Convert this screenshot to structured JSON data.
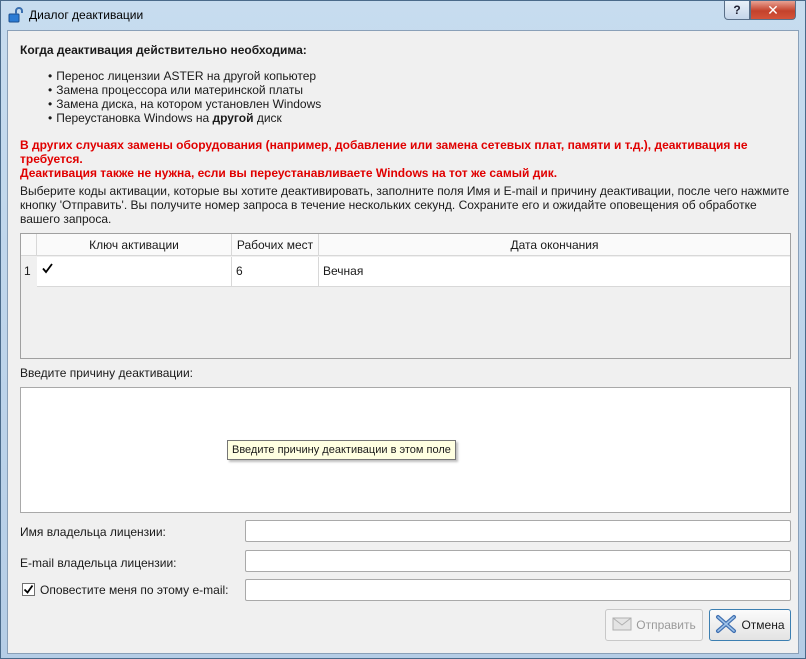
{
  "window": {
    "title": "Диалог деактивации",
    "help_label": "?",
    "close_label": "✕"
  },
  "content": {
    "heading": "Когда деактивация действительно необходима:",
    "bullets": [
      "Перенос лицензии ASTER на другой копьютер",
      "Замена процессора или материнской платы",
      "Замена диска, на котором установлен Windows"
    ],
    "bullet4_before": "Переустановка Windows на ",
    "bullet4_bold": "другой",
    "bullet4_after": " диск",
    "warning1": "В других случаях замены оборудования (например, добавление или замена сетевых плат, памяти и т.д.), деактивация не требуется.",
    "warning2": "Деактивация также не нужна, если вы переустанавливаете Windows на тот же самый дик.",
    "info": "Выберите коды активации, которые вы хотите деактивировать, заполните поля Имя и E-mail и причину деактивации, после чего нажмите кнопку 'Отправить'. Вы получите номер запроса в течение нескольких секунд. Сохраните его и ожидайте оповещения об обработке вашего запроса."
  },
  "table": {
    "columns": [
      "Ключ активации",
      "Рабочих мест",
      "Дата окончания"
    ],
    "rows": [
      {
        "num": "1",
        "checked": true,
        "key": "",
        "seats": "6",
        "expiry": "Вечная"
      }
    ]
  },
  "reason": {
    "label": "Введите причину деактивации:",
    "value": "",
    "tooltip": "Введите причину деактивации в этом поле"
  },
  "owner_name": {
    "label": "Имя владельца лицензии:",
    "value": ""
  },
  "owner_email": {
    "label": "E-mail владельца лицензии:",
    "value": ""
  },
  "notify": {
    "label": "Оповестите меня по этому e-mail:",
    "checked": true,
    "value": ""
  },
  "buttons": {
    "send": "Отправить",
    "cancel": "Отмена"
  },
  "colors": {
    "warning": "#e00000",
    "title_bg": "#b9d1ea"
  }
}
